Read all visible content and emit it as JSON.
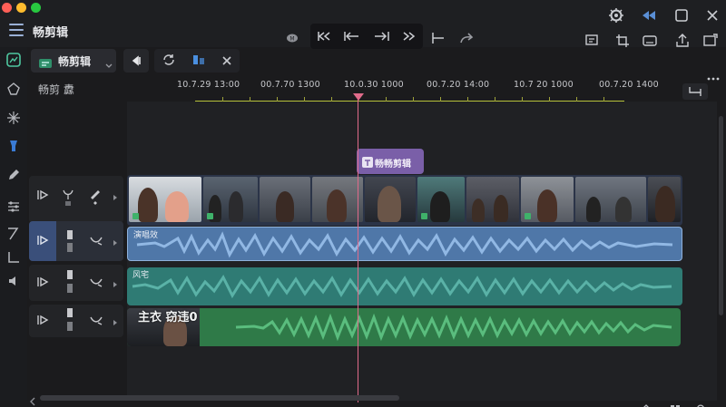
{
  "app": {
    "title": "畅剪辑"
  },
  "toolbar": {
    "project_name": "畅剪辑",
    "breadcrumb": "畅剪 纛"
  },
  "ruler": {
    "labels": [
      "10.7.29 13:00",
      "00.7.70 1300",
      "10.0.30 1000",
      "00.7.20 14:00",
      "10.7 20 1000",
      "00.7.20 1400"
    ]
  },
  "timeline": {
    "clip_tag": "畅畅剪辑",
    "tracks": [
      {
        "name": "video-track"
      },
      {
        "name": "audio-1",
        "label": "演唱效"
      },
      {
        "name": "audio-2",
        "label": "风宅"
      },
      {
        "name": "audio-3",
        "label": "主衣 窃违0"
      }
    ]
  },
  "colors": {
    "accent": "#5a8fd6",
    "playhead": "#e06b8b",
    "audio1": "#4f77a8",
    "audio2": "#2f7b74",
    "audio3": "#2f7a48",
    "video_track": "#2b3448",
    "clip_tag": "#7a5fa8"
  }
}
